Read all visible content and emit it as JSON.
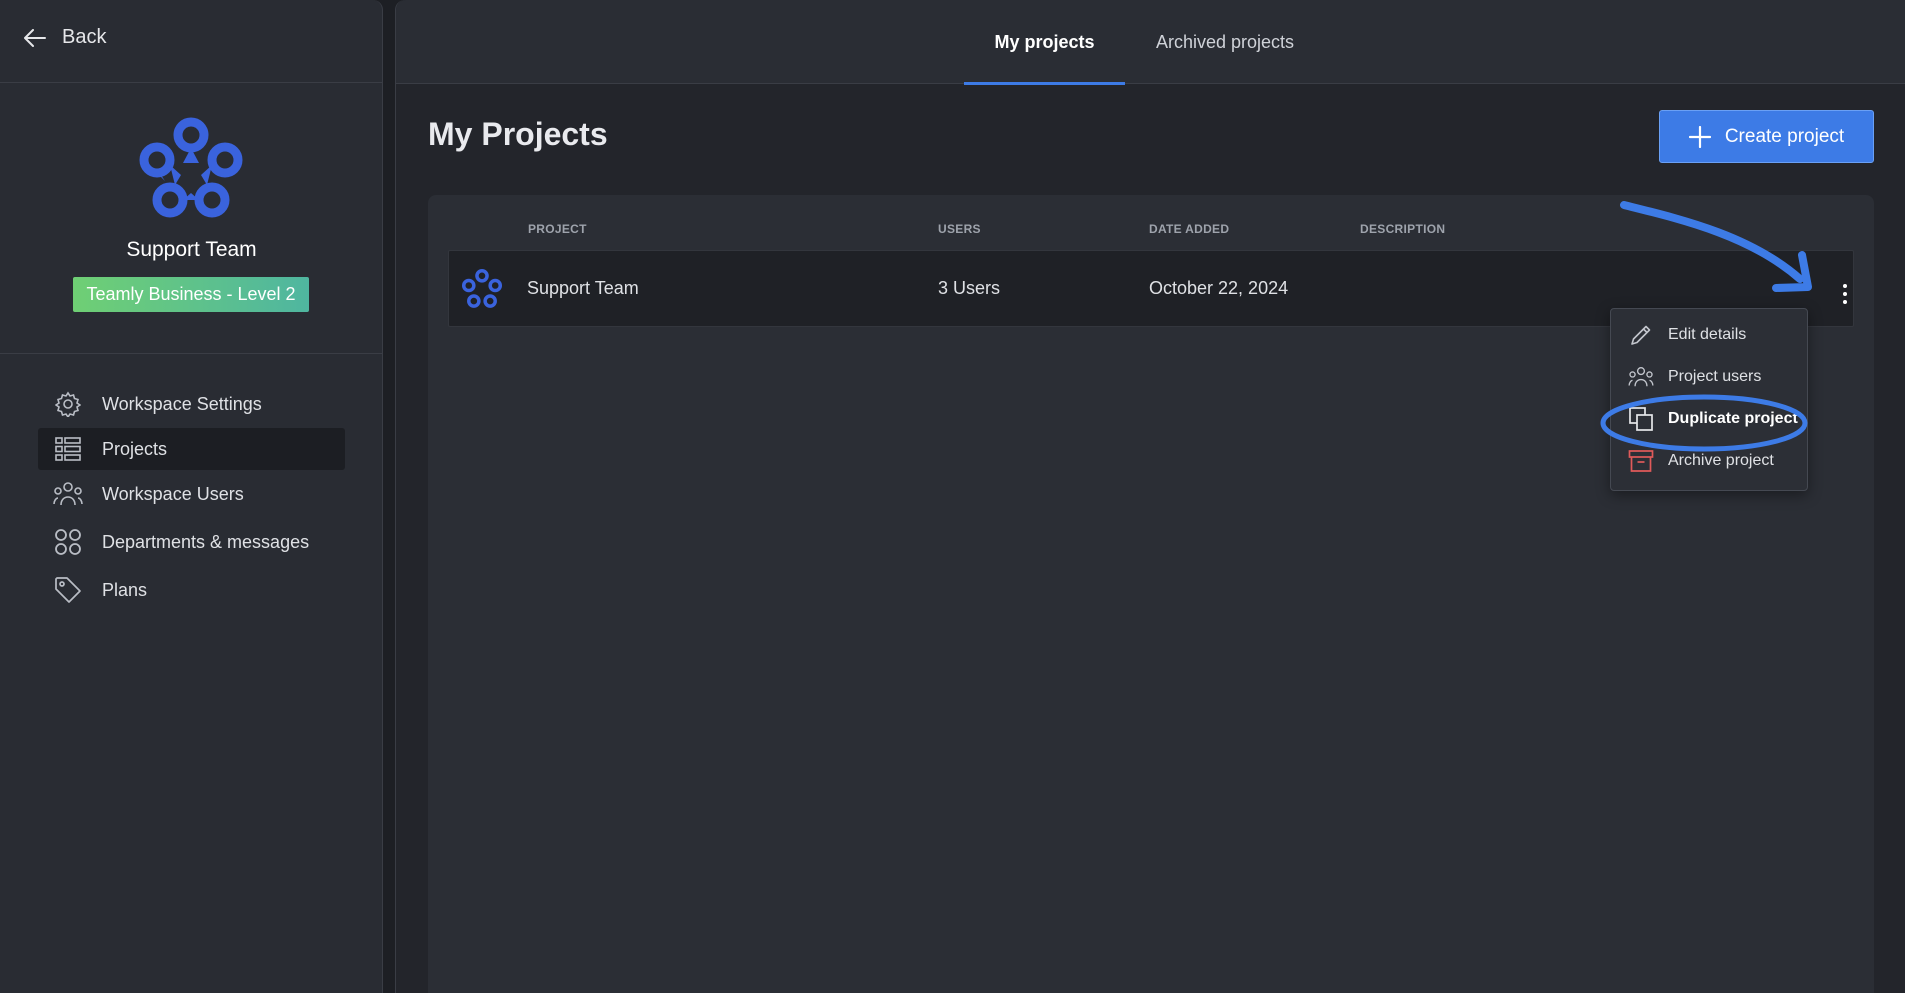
{
  "sidebar": {
    "back_label": "Back",
    "team_name": "Support Team",
    "plan_badge": "Teamly Business - Level 2",
    "items": [
      {
        "label": "Workspace Settings",
        "icon": "gear-icon"
      },
      {
        "label": "Projects",
        "icon": "projects-list-icon",
        "active": true
      },
      {
        "label": "Workspace Users",
        "icon": "users-group-icon"
      },
      {
        "label": "Departments & messages",
        "icon": "grid-circles-icon"
      },
      {
        "label": "Plans",
        "icon": "tag-icon"
      }
    ]
  },
  "tabs": [
    {
      "label": "My projects",
      "active": true
    },
    {
      "label": "Archived projects",
      "active": false
    }
  ],
  "main": {
    "title": "My Projects",
    "create_button": "Create project"
  },
  "table": {
    "headers": [
      "PROJECT",
      "USERS",
      "DATE ADDED",
      "DESCRIPTION"
    ],
    "rows": [
      {
        "project": "Support Team",
        "users": "3 Users",
        "date_added": "October 22, 2024",
        "description": ""
      }
    ]
  },
  "context_menu": {
    "items": [
      {
        "label": "Edit details",
        "icon": "pencil-icon"
      },
      {
        "label": "Project users",
        "icon": "users-group-icon"
      },
      {
        "label": "Duplicate project",
        "icon": "duplicate-icon",
        "highlighted": true
      },
      {
        "label": "Archive project",
        "icon": "archive-box-icon"
      }
    ]
  },
  "colors": {
    "accent": "#3d7be6",
    "logo_blue": "#3a63dd",
    "badge_start": "#6fcf74",
    "badge_end": "#4fb6a0",
    "archive_red": "#e05a5a"
  }
}
